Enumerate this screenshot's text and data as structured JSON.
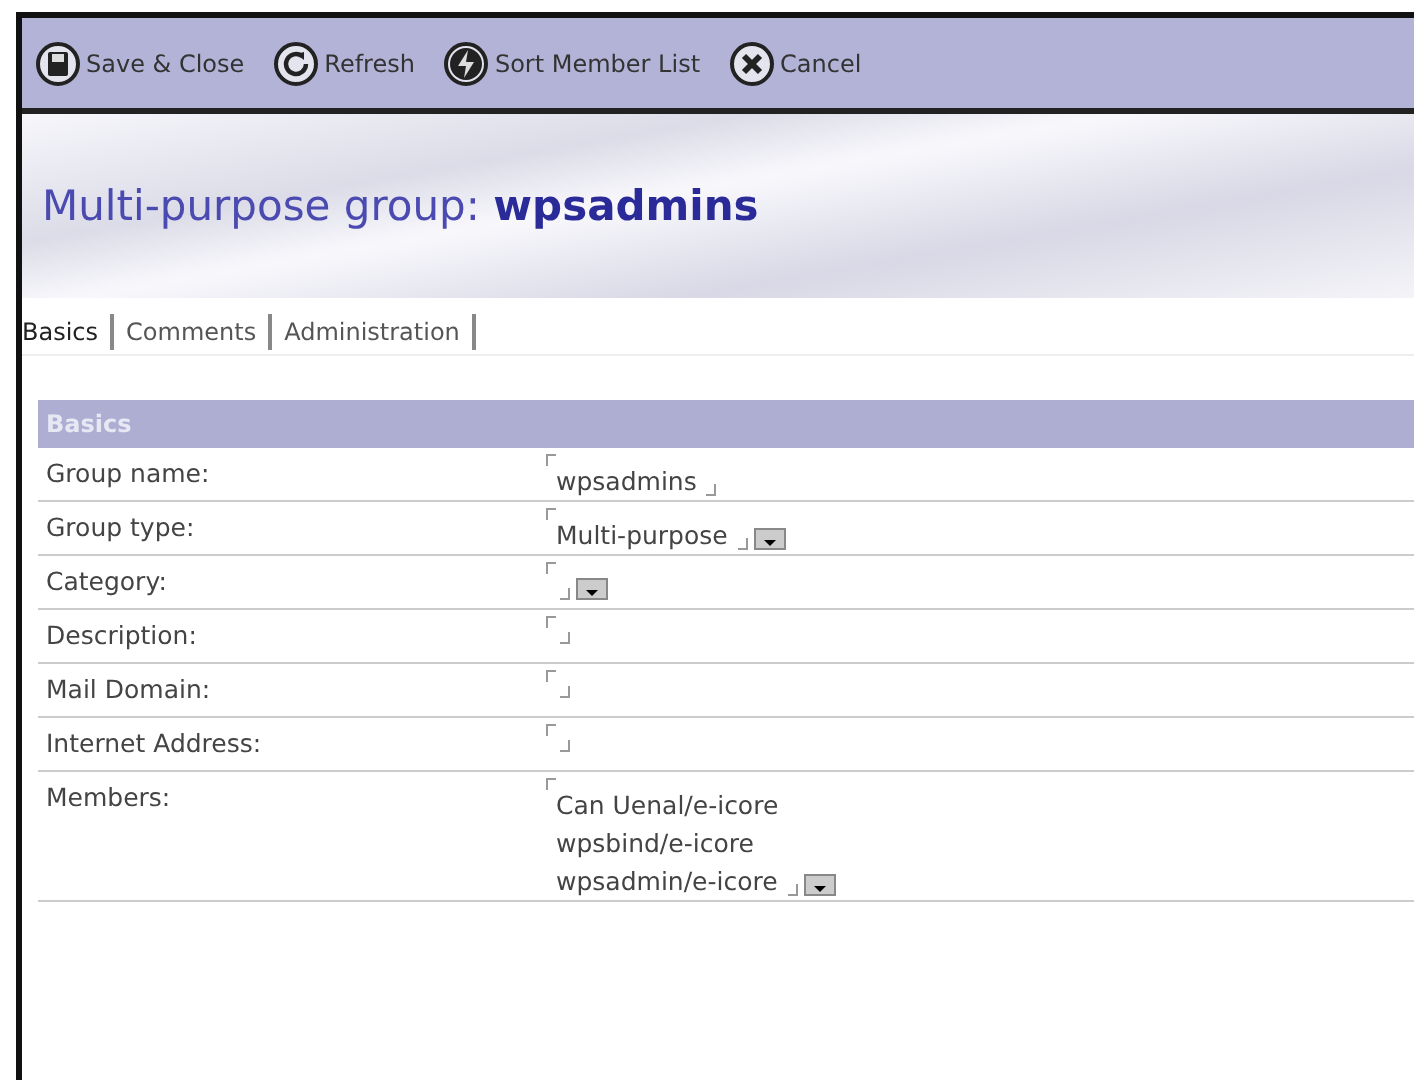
{
  "toolbar": [
    {
      "label": "Save & Close",
      "kind": "save"
    },
    {
      "label": "Refresh",
      "kind": "refresh"
    },
    {
      "label": "Sort Member List",
      "kind": "sort"
    },
    {
      "label": "Cancel",
      "kind": "cancel"
    }
  ],
  "title": "Multi-purpose group: **wpsadmins**",
  "tabs": [
    {
      "label": "Basics",
      "selected": true
    },
    {
      "label": "Comments",
      "selected": false
    },
    {
      "label": "Administration",
      "selected": false
    }
  ],
  "section": {
    "title": "Basics",
    "fields": [
      {
        "label": "Group name:",
        "value": "wpsadmins",
        "dropdown": false
      },
      {
        "label": "Group type:",
        "value": "Multi-purpose",
        "dropdown": true
      },
      {
        "label": "Category:",
        "dropdown": true
      },
      {
        "label": "Description:",
        "dropdown": false
      },
      {
        "label": "Mail Domain:",
        "dropdown": false
      },
      {
        "label": "Internet Address:",
        "dropdown": false
      },
      {
        "label": "Members:",
        "lines": [
          "Can Uenal/e-icore",
          "wpsbind/e-icore",
          "wpsadmin/e-icore"
        ],
        "dropdown": true
      }
    ]
  }
}
